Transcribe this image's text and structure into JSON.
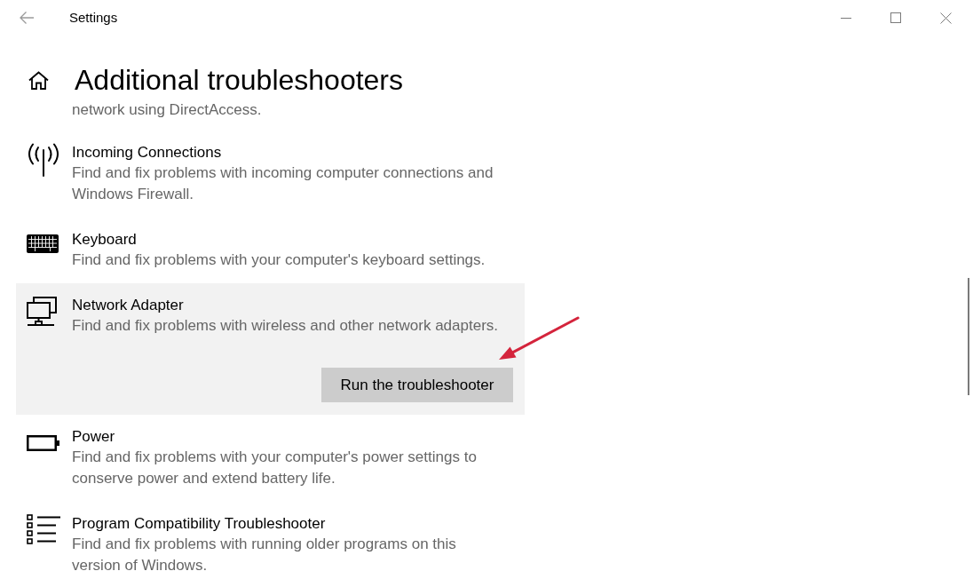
{
  "window": {
    "title": "Settings"
  },
  "page": {
    "heading": "Additional troubleshooters"
  },
  "troubleshooters": [
    {
      "description": "network using DirectAccess.",
      "selected": false
    },
    {
      "title": "Incoming Connections",
      "description": "Find and fix problems with incoming computer connections and Windows Firewall.",
      "selected": false
    },
    {
      "title": "Keyboard",
      "description": "Find and fix problems with your computer's keyboard settings.",
      "selected": false
    },
    {
      "title": "Network Adapter",
      "description": "Find and fix problems with wireless and other network adapters.",
      "selected": true,
      "button": "Run the troubleshooter"
    },
    {
      "title": "Power",
      "description": "Find and fix problems with your computer's power settings to conserve power and extend battery life.",
      "selected": false
    },
    {
      "title": "Program Compatibility Troubleshooter",
      "description": "Find and fix problems with running older programs on this version of Windows.",
      "selected": false
    }
  ]
}
